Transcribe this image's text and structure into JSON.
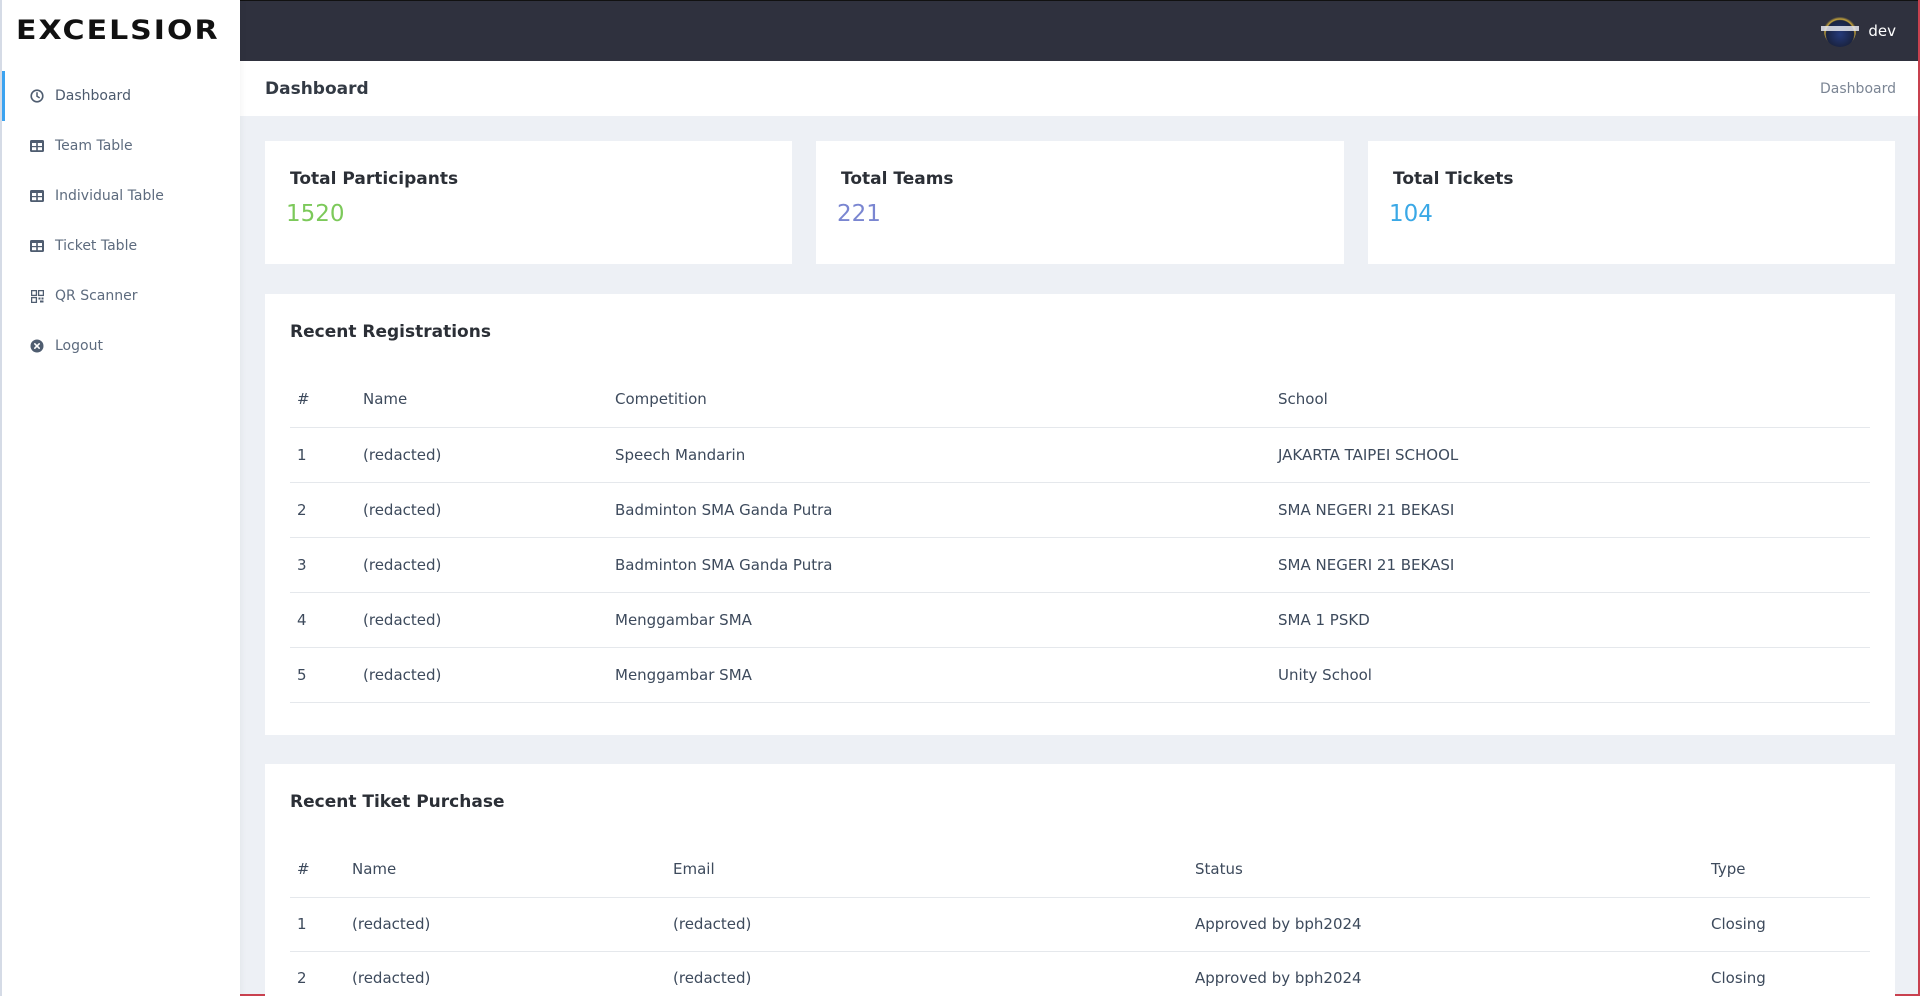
{
  "app": {
    "logo_text": "EXCELSIOR"
  },
  "sidebar": {
    "items": [
      {
        "label": "Dashboard",
        "icon": "clock-icon",
        "active": true
      },
      {
        "label": "Team Table",
        "icon": "table-icon",
        "active": false
      },
      {
        "label": "Individual Table",
        "icon": "table-icon",
        "active": false
      },
      {
        "label": "Ticket Table",
        "icon": "table-icon",
        "active": false
      },
      {
        "label": "QR Scanner",
        "icon": "qrcode-icon",
        "active": false
      },
      {
        "label": "Logout",
        "icon": "close-circle-icon",
        "active": false
      }
    ]
  },
  "topbar": {
    "user_name": "dev",
    "avatar_icon": "avatar-icon"
  },
  "page_header": {
    "title": "Dashboard",
    "breadcrumb": "Dashboard"
  },
  "stats": [
    {
      "title": "Total Participants",
      "value": "1520",
      "color": "#7cc95a"
    },
    {
      "title": "Total Teams",
      "value": "221",
      "color": "#7a86d1"
    },
    {
      "title": "Total Tickets",
      "value": "104",
      "color": "#3aa8e6"
    }
  ],
  "recent_registrations": {
    "title": "Recent Registrations",
    "columns": [
      "#",
      "Name",
      "Competition",
      "School"
    ],
    "rows": [
      [
        "1",
        "(redacted)",
        "Speech Mandarin",
        "JAKARTA TAIPEI SCHOOL"
      ],
      [
        "2",
        "(redacted)",
        "Badminton SMA Ganda Putra",
        "SMA NEGERI 21 BEKASI"
      ],
      [
        "3",
        "(redacted)",
        "Badminton SMA Ganda Putra",
        "SMA NEGERI 21 BEKASI"
      ],
      [
        "4",
        "(redacted)",
        "Menggambar SMA",
        "SMA 1 PSKD"
      ],
      [
        "5",
        "(redacted)",
        "Menggambar SMA",
        "Unity School"
      ]
    ]
  },
  "recent_tickets": {
    "title": "Recent Tiket Purchase",
    "columns": [
      "#",
      "Name",
      "Email",
      "Status",
      "Type"
    ],
    "rows": [
      [
        "1",
        "(redacted)",
        "(redacted)",
        "Approved by bph2024",
        "Closing"
      ],
      [
        "2",
        "(redacted)",
        "(redacted)",
        "Approved by bph2024",
        "Closing"
      ]
    ]
  }
}
